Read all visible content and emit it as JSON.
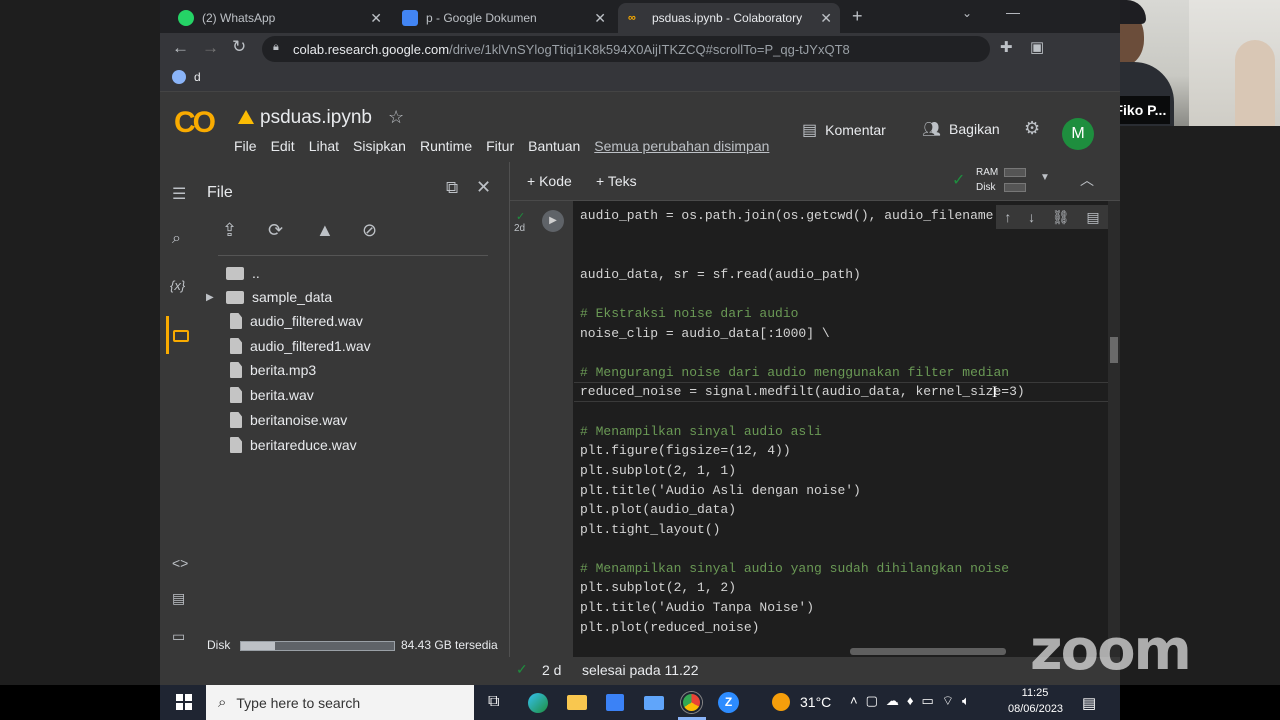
{
  "browser": {
    "tabs": [
      {
        "label": "(2) WhatsApp",
        "color": "#25d366"
      },
      {
        "label": "p - Google Dokumen",
        "color": "#4285f4"
      },
      {
        "label": "psduas.ipynb - Colaboratory",
        "color": "#f9ab00"
      }
    ],
    "url_host": "colab.research.google.com",
    "url_path": "/drive/1klVnSYlogTtiqi1K8k594X0AijITKZCQ#scrollTo=P_qg-tJYxQT8",
    "bookmark_label": "d"
  },
  "colab": {
    "logo": "CO",
    "notebook_title": "psduas.ipynb",
    "menu": [
      "File",
      "Edit",
      "Lihat",
      "Sisipkan",
      "Runtime",
      "Fitur",
      "Bantuan"
    ],
    "save_status": "Semua perubahan disimpan",
    "comment_label": "Komentar",
    "share_label": "Bagikan",
    "avatar_letter": "M",
    "add_code_label": "+ Kode",
    "add_text_label": "+ Teks",
    "ram_label": "RAM",
    "disk_label": "Disk",
    "cell_exec_time": "2d"
  },
  "filepanel": {
    "title": "File",
    "items": [
      {
        "name": "..",
        "type": "up"
      },
      {
        "name": "sample_data",
        "type": "folder"
      },
      {
        "name": "audio_filtered.wav",
        "type": "file"
      },
      {
        "name": "audio_filtered1.wav",
        "type": "file"
      },
      {
        "name": "berita.mp3",
        "type": "file"
      },
      {
        "name": "berita.wav",
        "type": "file"
      },
      {
        "name": "beritanoise.wav",
        "type": "file"
      },
      {
        "name": "beritareduce.wav",
        "type": "file"
      }
    ],
    "disk_label": "Disk",
    "disk_free": "84.43 GB tersedia",
    "disk_used_fraction": 0.22
  },
  "code": {
    "lines": [
      "audio_path = os.path.join(os.getcwd(), audio_filename",
      "audio_data, sr = sf.read(audio_path)",
      "# Ekstraksi noise dari audio",
      "noise_clip = audio_data[:1000] \\",
      "# Mengurangi noise dari audio menggunakan filter median",
      "reduced_noise = signal.medfilt(audio_data, kernel_size=3)",
      "# Menampilkan sinyal audio asli",
      "plt.figure(figsize=(12, 4))",
      "plt.subplot(2, 1, 1)",
      "plt.title('Audio Asli dengan noise')",
      "plt.plot(audio_data)",
      "plt.tight_layout()",
      "# Menampilkan sinyal audio yang sudah dihilangkan noise",
      "plt.subplot(2, 1, 2)",
      "plt.title('Audio Tanpa Noise')",
      "plt.plot(reduced_noise)"
    ]
  },
  "status": {
    "exec_time": "2 d",
    "completed": "selesai pada 11.22"
  },
  "zoom": {
    "participant_name": "Maheza Fiko P...",
    "watermark": "zoom"
  },
  "taskbar": {
    "search_placeholder": "Type here to search",
    "temperature": "31°C",
    "time": "11:25",
    "date": "08/06/2023"
  }
}
